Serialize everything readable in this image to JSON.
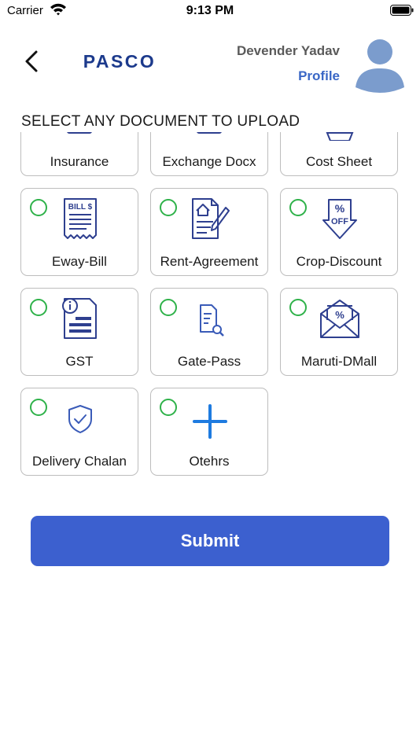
{
  "status_bar": {
    "carrier": "Carrier",
    "time": "9:13 PM"
  },
  "header": {
    "logo_text": "PASCO",
    "user_name": "Devender Yadav",
    "profile_label": "Profile"
  },
  "section_title": "SELECT ANY DOCUMENT TO UPLOAD",
  "documents": [
    {
      "label": "Insurance",
      "icon": "insurance-icon"
    },
    {
      "label": "Exchange Docx",
      "icon": "exchange-icon"
    },
    {
      "label": "Cost Sheet",
      "icon": "cost-sheet-icon"
    },
    {
      "label": "Eway-Bill",
      "icon": "bill-receipt-icon"
    },
    {
      "label": "Rent-Agreement",
      "icon": "house-document-pen-icon"
    },
    {
      "label": "Crop-Discount",
      "icon": "percent-off-tag-icon"
    },
    {
      "label": "GST",
      "icon": "info-document-icon"
    },
    {
      "label": "Gate-Pass",
      "icon": "document-search-icon"
    },
    {
      "label": "Maruti-DMall",
      "icon": "percent-envelope-icon"
    },
    {
      "label": "Delivery Chalan",
      "icon": "shield-check-icon"
    },
    {
      "label": "Otehrs",
      "icon": "plus-icon"
    }
  ],
  "submit_label": "Submit",
  "colors": {
    "primary": "#3C60CF",
    "link": "#3A67C6",
    "radio": "#2FB24A",
    "icon": "#2E3F8F",
    "plus": "#1E7BE0"
  }
}
